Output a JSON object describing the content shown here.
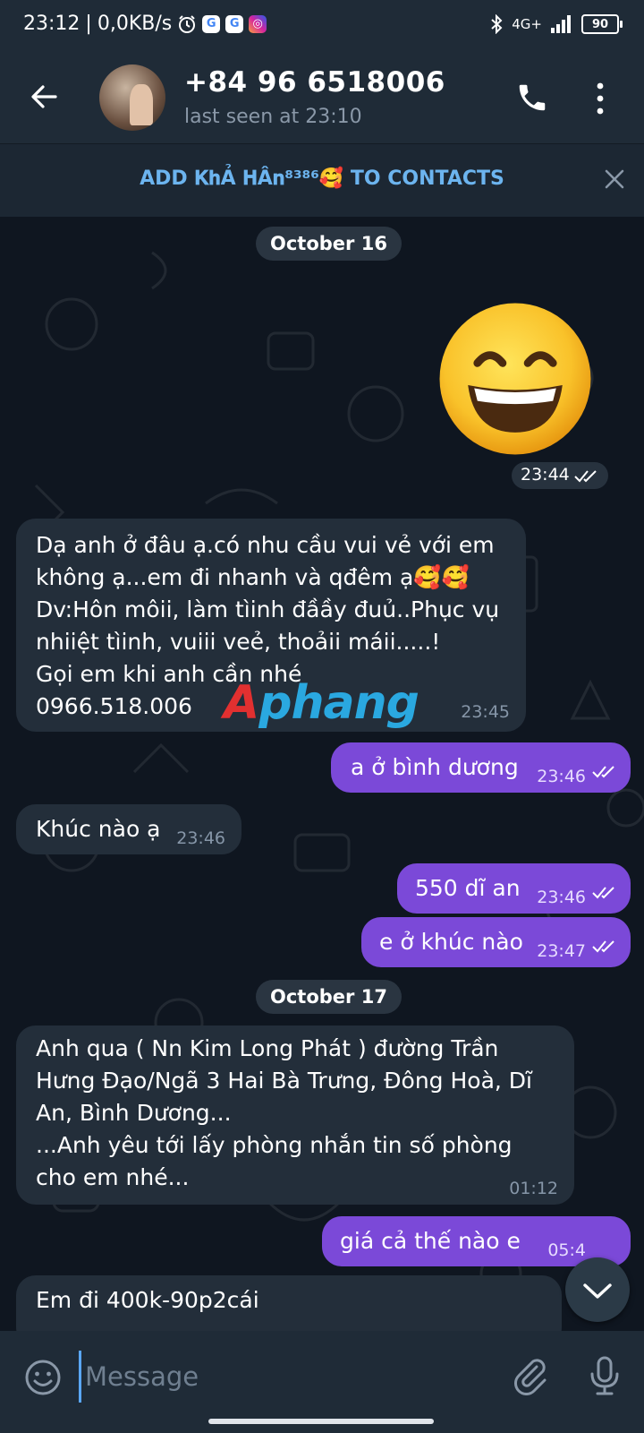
{
  "status_bar": {
    "time": "23:12",
    "speed": "0,0KB/s",
    "network": "4G+",
    "battery": "90"
  },
  "header": {
    "contact_name": "+84 96 6518006",
    "last_seen": "last seen at 23:10"
  },
  "add_contact": {
    "text": "ADD 𝐊𝐡Ả 𝐇Â𝐧⁸³⁸⁶🥰 TO CONTACTS"
  },
  "dates": {
    "first": "October 16",
    "second": "October 17"
  },
  "messages": [
    {
      "id": "m1",
      "dir": "out",
      "type": "emoji",
      "text": "😄",
      "time": "23:44"
    },
    {
      "id": "m2",
      "dir": "in",
      "text": "Dạ anh ở đâu ạ.có nhu cầu vui vẻ với em\nkhông ạ...em đi nhanh và qđêm ạ🥰🥰\nDv:Hôn môii, làm tìinh đầầy đuủ..Phục vụ\nnhiiệt tìinh, vuiii veẻ, thoảii máii.....!\nGọi em khi anh cần nhé\n0966.518.006",
      "time": "23:45"
    },
    {
      "id": "m3",
      "dir": "out",
      "text": "a ở bình dương",
      "time": "23:46"
    },
    {
      "id": "m4",
      "dir": "in",
      "text": "Khúc nào ạ",
      "time": "23:46"
    },
    {
      "id": "m5",
      "dir": "out",
      "text": "550 dĩ an",
      "time": "23:46"
    },
    {
      "id": "m6",
      "dir": "out",
      "text": "e ở khúc nào",
      "time": "23:47"
    },
    {
      "id": "m7",
      "dir": "in",
      "text": "Anh qua ( Nn Kim Long Phát ) đường Trần\nHưng Đạo/Ngã 3 Hai Bà Trưng, Đông Hoà, Dĩ\nAn, Bình Dương...\n...Anh yêu tới lấy phòng nhắn tin số phòng\ncho em nhé...",
      "time": "01:12"
    },
    {
      "id": "m8",
      "dir": "out",
      "text": "giá cả thế nào e",
      "time": "05:4"
    },
    {
      "id": "m9",
      "dir": "in",
      "text": "Em đi 400k-90p2cái",
      "time": ""
    }
  ],
  "watermark": {
    "part1": "A",
    "part2": "phang"
  },
  "input": {
    "placeholder": "Message"
  },
  "icons": {
    "back": "arrow-left-icon",
    "call": "phone-icon",
    "more": "more-vertical-icon",
    "close": "close-icon",
    "emoji": "smile-icon",
    "attach": "paperclip-icon",
    "mic": "microphone-icon",
    "scroll": "chevron-down-icon",
    "read": "double-check-icon"
  },
  "colors": {
    "accent": "#6cb4ef",
    "outgoing_bubble": "#7b49d8",
    "incoming_bubble": "#232e3a",
    "background": "#0f1620"
  }
}
